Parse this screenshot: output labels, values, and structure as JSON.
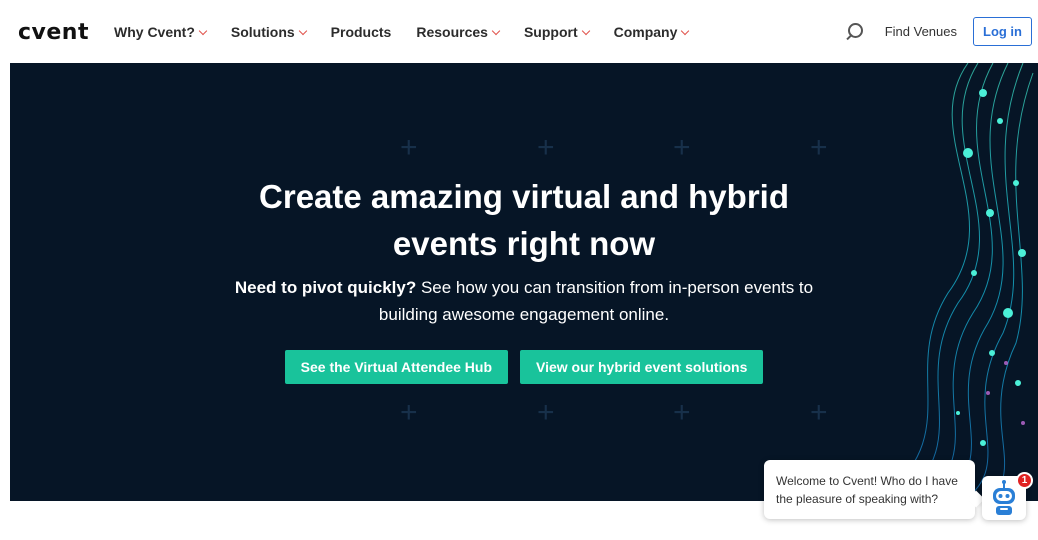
{
  "brand": {
    "logo_text": "cvent",
    "accent": "#e0524b"
  },
  "nav": {
    "items": [
      {
        "label": "Why Cvent?",
        "dropdown": true
      },
      {
        "label": "Solutions",
        "dropdown": true
      },
      {
        "label": "Products",
        "dropdown": false
      },
      {
        "label": "Resources",
        "dropdown": true
      },
      {
        "label": "Support",
        "dropdown": true
      },
      {
        "label": "Company",
        "dropdown": true
      }
    ],
    "find_venues": "Find Venues",
    "login": "Log in"
  },
  "hero": {
    "title_line1": "Create amazing virtual and hybrid",
    "title_line2": "events right now",
    "sub_bold": "Need to pivot quickly?",
    "sub_rest_line1": " See how you can transition from in-person events to",
    "sub_line2": "building awesome engagement online.",
    "cta_primary": "See the Virtual Attendee Hub",
    "cta_secondary": "View our hybrid event solutions",
    "cta_color": "#19c39b",
    "background": "#061526"
  },
  "chat": {
    "message": "Welcome to Cvent! Who do I have the pleasure of speaking with?",
    "badge_count": "1"
  },
  "icons": {
    "search": "search-icon",
    "dropdown": "chevron-down-icon",
    "chatbot": "robot-icon"
  }
}
